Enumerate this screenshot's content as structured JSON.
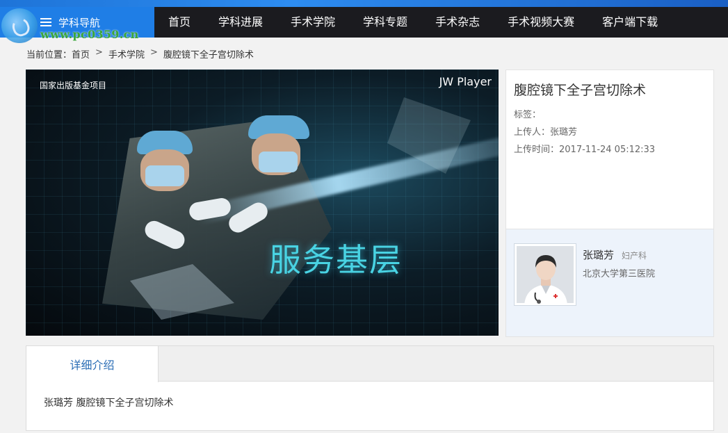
{
  "nav": {
    "menu_label": "学科导航",
    "items": [
      "首页",
      "学科进展",
      "手术学院",
      "学科专题",
      "手术杂志",
      "手术视频大赛",
      "客户端下载"
    ]
  },
  "watermark": {
    "url_text": "www.pc0359.cn"
  },
  "breadcrumb": {
    "prefix": "当前位置：",
    "items": [
      "首页",
      "手术学院",
      "腹腔镜下全子宫切除术"
    ],
    "separator": ">"
  },
  "video": {
    "top_left_text": "国家出版基金项目",
    "player_label": "JW Player",
    "overlay_text": "服务基层"
  },
  "info": {
    "title": "腹腔镜下全子宫切除术",
    "tags_label": "标签：",
    "uploader_label": "上传人：张璐芳",
    "upload_time_label": "上传时间：2017-11-24 05:12:33"
  },
  "doctor": {
    "name": "张璐芳",
    "department": "妇产科",
    "hospital": "北京大学第三医院"
  },
  "detail": {
    "tab_label": "详细介绍",
    "content": "张璐芳 腹腔镜下全子宫切除术"
  },
  "colors": {
    "nav_bg": "#1b1b1f",
    "nav_accent": "#1f7ee6",
    "tab_text": "#2a6db5",
    "video_text": "#49d3e3",
    "doctor_panel_bg": "#edf3fb"
  }
}
